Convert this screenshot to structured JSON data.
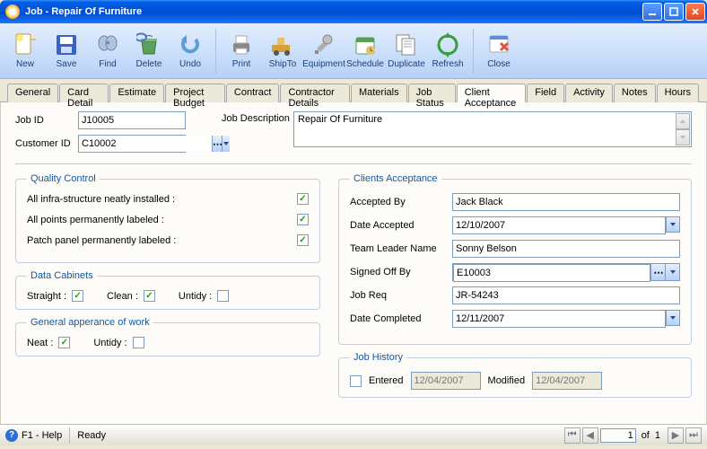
{
  "window": {
    "title": "Job - Repair Of Furniture"
  },
  "toolbar": [
    {
      "id": "new",
      "label": "New"
    },
    {
      "id": "save",
      "label": "Save"
    },
    {
      "id": "find",
      "label": "Find"
    },
    {
      "id": "delete",
      "label": "Delete"
    },
    {
      "id": "undo",
      "label": "Undo"
    },
    {
      "id": "sep"
    },
    {
      "id": "print",
      "label": "Print"
    },
    {
      "id": "shipto",
      "label": "ShipTo"
    },
    {
      "id": "equipment",
      "label": "Equipment"
    },
    {
      "id": "schedule",
      "label": "Schedule"
    },
    {
      "id": "duplicate",
      "label": "Duplicate"
    },
    {
      "id": "refresh",
      "label": "Refresh"
    },
    {
      "id": "sep"
    },
    {
      "id": "close",
      "label": "Close"
    }
  ],
  "tabs": [
    "General",
    "Card Detail",
    "Estimate",
    "Project Budget",
    "Contract",
    "Contractor Details",
    "Materials",
    "Job Status",
    "Client Acceptance",
    "Field",
    "Activity",
    "Notes",
    "Hours"
  ],
  "active_tab": "Client Acceptance",
  "header": {
    "job_id_label": "Job ID",
    "job_id": "J10005",
    "customer_id_label": "Customer ID",
    "customer_id": "C10002",
    "job_desc_label": "Job Description",
    "job_desc": "Repair Of Furniture"
  },
  "quality_control": {
    "legend": "Quality Control",
    "items": [
      {
        "label": "All infra-structure neatly installed :",
        "checked": true
      },
      {
        "label": "All points permanently labeled :",
        "checked": true
      },
      {
        "label": "Patch panel permanently labeled :",
        "checked": true
      }
    ]
  },
  "data_cabinets": {
    "legend": "Data Cabinets",
    "items": [
      {
        "label": "Straight :",
        "checked": true
      },
      {
        "label": "Clean :",
        "checked": true
      },
      {
        "label": "Untidy :",
        "checked": false
      }
    ]
  },
  "general_appearance": {
    "legend": "General apperance of work",
    "items": [
      {
        "label": "Neat :",
        "checked": true
      },
      {
        "label": "Untidy :",
        "checked": false
      }
    ]
  },
  "clients_acceptance": {
    "legend": "Clients Acceptance",
    "accepted_by": {
      "label": "Accepted By",
      "value": "Jack Black"
    },
    "date_accepted": {
      "label": "Date Accepted",
      "value": "12/10/2007"
    },
    "team_leader": {
      "label": "Team Leader Name",
      "value": "Sonny Belson"
    },
    "signed_off": {
      "label": "Signed Off By",
      "value": "E10003"
    },
    "job_req": {
      "label": "Job Req",
      "value": "JR-54243"
    },
    "date_completed": {
      "label": "Date Completed",
      "value": "12/11/2007"
    }
  },
  "job_history": {
    "legend": "Job History",
    "entered": {
      "label": "Entered",
      "value": "12/04/2007",
      "checked": false
    },
    "modified": {
      "label": "Modified",
      "value": "12/04/2007"
    }
  },
  "statusbar": {
    "help": "F1 - Help",
    "ready": "Ready",
    "page": "1",
    "of": "of",
    "total": "1"
  },
  "icons": {
    "new": "#f5c542",
    "save": "#3a62c7",
    "find": "#8aa5c9",
    "delete": "#5aa05a",
    "undo": "#5a9ed6",
    "print": "#888",
    "shipto": "#d6a13a",
    "equipment": "#b0b0b0",
    "schedule": "#5a9e5a",
    "duplicate": "#888",
    "refresh": "#3aa03a",
    "close": "#d65a3a"
  }
}
